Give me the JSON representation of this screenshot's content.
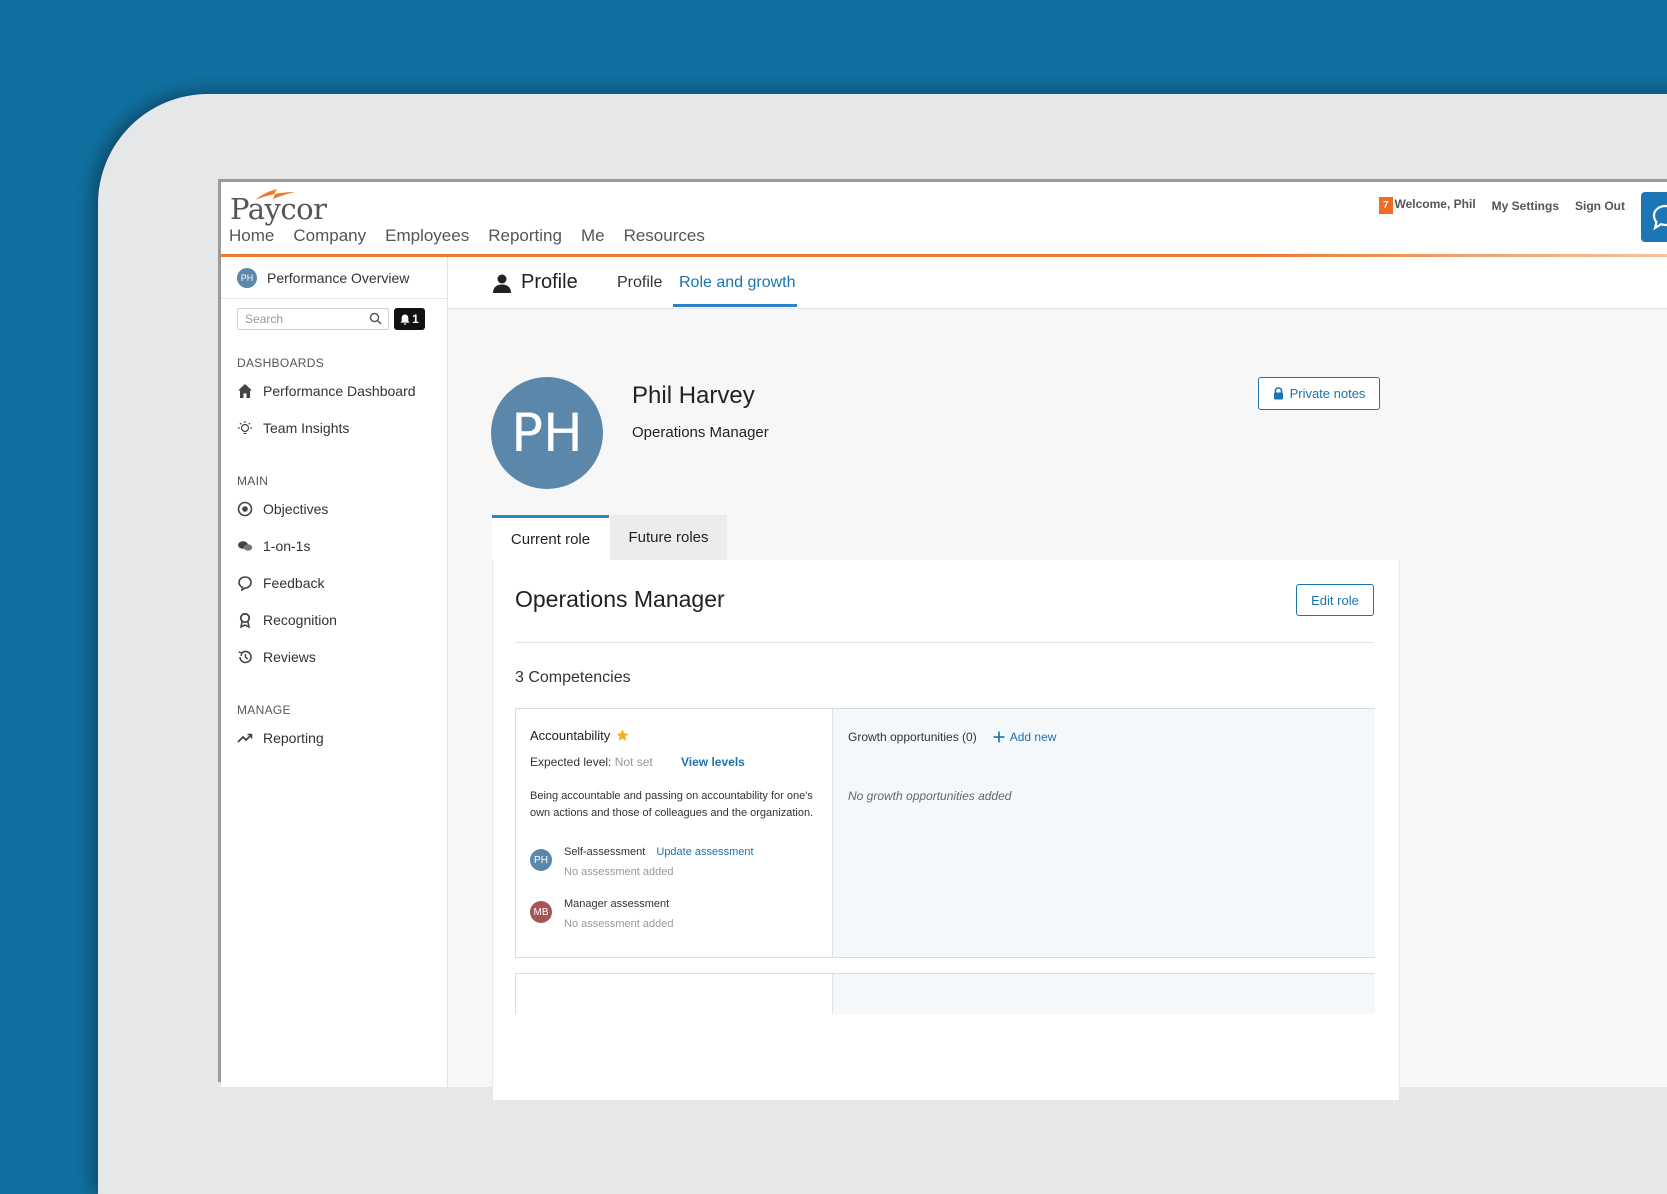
{
  "brand": {
    "logo_text": "Paycor",
    "accent": "#ee7a2b",
    "primary": "#1b73b0",
    "background": "#11709f"
  },
  "header": {
    "nav": [
      "Home",
      "Company",
      "Employees",
      "Reporting",
      "Me",
      "Resources"
    ],
    "notification_count": "7",
    "welcome": "Welcome, Phil",
    "settings": "My Settings",
    "sign_out": "Sign Out",
    "chat_icon": "chat-bubble-icon"
  },
  "sidebar": {
    "user_initials": "PH",
    "title": "Performance Overview",
    "search_placeholder": "Search",
    "bell_count": "1",
    "sections": [
      {
        "title": "DASHBOARDS",
        "items": [
          {
            "label": "Performance Dashboard",
            "icon": "home-icon"
          },
          {
            "label": "Team Insights",
            "icon": "lightbulb-icon"
          }
        ]
      },
      {
        "title": "MAIN",
        "items": [
          {
            "label": "Objectives",
            "icon": "target-icon"
          },
          {
            "label": "1-on-1s",
            "icon": "chat-icon"
          },
          {
            "label": "Feedback",
            "icon": "feedback-icon"
          },
          {
            "label": "Recognition",
            "icon": "ribbon-icon"
          },
          {
            "label": "Reviews",
            "icon": "history-icon"
          }
        ]
      },
      {
        "title": "MANAGE",
        "items": [
          {
            "label": "Reporting",
            "icon": "trend-icon"
          }
        ]
      }
    ]
  },
  "main": {
    "page_title": "Profile",
    "tabs": [
      {
        "label": "Profile",
        "active": false
      },
      {
        "label": "Role and growth",
        "active": true
      }
    ],
    "profile": {
      "initials": "PH",
      "name": "Phil Harvey",
      "title": "Operations Manager",
      "private_notes_label": "Private notes"
    },
    "role_tabs": [
      {
        "label": "Current role",
        "active": true
      },
      {
        "label": "Future roles",
        "active": false
      }
    ],
    "role": {
      "name": "Operations Manager",
      "edit_label": "Edit role",
      "competencies_label": "3 Competencies",
      "competency": {
        "name": "Accountability",
        "expected_label": "Expected level:",
        "expected_value": "Not set",
        "view_levels": "View levels",
        "description": "Being accountable and passing on accountability for one's own actions and those of colleagues and the organization.",
        "self": {
          "initials": "PH",
          "label": "Self-assessment",
          "action": "Update assessment",
          "status": "No assessment added",
          "color": "#5b87aa"
        },
        "manager": {
          "initials": "MB",
          "label": "Manager assessment",
          "status": "No assessment added",
          "color": "#a85454"
        },
        "growth_label": "Growth opportunities (0)",
        "add_new": "Add new",
        "no_growth": "No growth opportunities added"
      }
    }
  }
}
